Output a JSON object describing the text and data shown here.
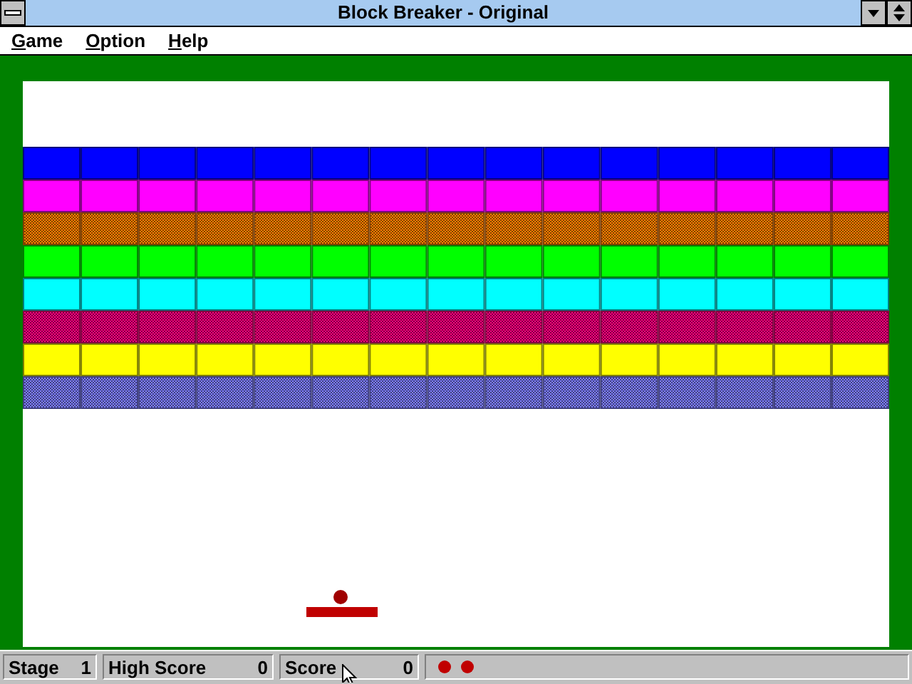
{
  "window": {
    "title": "Block Breaker - Original"
  },
  "menu": [
    {
      "label": "Game"
    },
    {
      "label": "Option"
    },
    {
      "label": "Help"
    }
  ],
  "bricks": [
    {
      "color": "#0000ff",
      "dithered": false,
      "bricks": [
        true,
        true,
        true,
        true,
        true,
        true,
        true,
        true,
        true,
        true,
        true,
        true,
        true,
        true,
        true
      ]
    },
    {
      "color": "#ff00ff",
      "dithered": false,
      "bricks": [
        true,
        true,
        true,
        true,
        true,
        true,
        true,
        true,
        true,
        true,
        true,
        true,
        true,
        true,
        true
      ]
    },
    {
      "color": "#ff8000",
      "dithered": true,
      "bricks": [
        true,
        true,
        true,
        true,
        true,
        true,
        true,
        true,
        true,
        true,
        true,
        true,
        true,
        true,
        true
      ]
    },
    {
      "color": "#00ff00",
      "dithered": false,
      "bricks": [
        true,
        true,
        true,
        true,
        true,
        true,
        true,
        true,
        true,
        true,
        true,
        true,
        true,
        true,
        true
      ]
    },
    {
      "color": "#00ffff",
      "dithered": false,
      "bricks": [
        true,
        true,
        true,
        true,
        true,
        true,
        true,
        true,
        true,
        true,
        true,
        true,
        true,
        true,
        true
      ]
    },
    {
      "color": "#ff0080",
      "dithered": true,
      "bricks": [
        true,
        true,
        true,
        true,
        true,
        true,
        true,
        true,
        true,
        true,
        true,
        true,
        true,
        true,
        true
      ]
    },
    {
      "color": "#ffff00",
      "dithered": false,
      "bricks": [
        true,
        true,
        true,
        true,
        true,
        true,
        true,
        true,
        true,
        true,
        true,
        true,
        true,
        true,
        true
      ]
    },
    {
      "color": "#8080ff",
      "dithered": true,
      "bricks": [
        true,
        true,
        true,
        true,
        true,
        true,
        true,
        true,
        true,
        true,
        true,
        true,
        true,
        true,
        true
      ]
    }
  ],
  "status": {
    "stage_label": "Stage",
    "stage": "1",
    "high_score_label": "High Score",
    "high_score": "0",
    "score_label": "Score",
    "score": "0"
  },
  "lives": [
    {
      "kind": "ball"
    },
    {
      "kind": "ball"
    }
  ]
}
